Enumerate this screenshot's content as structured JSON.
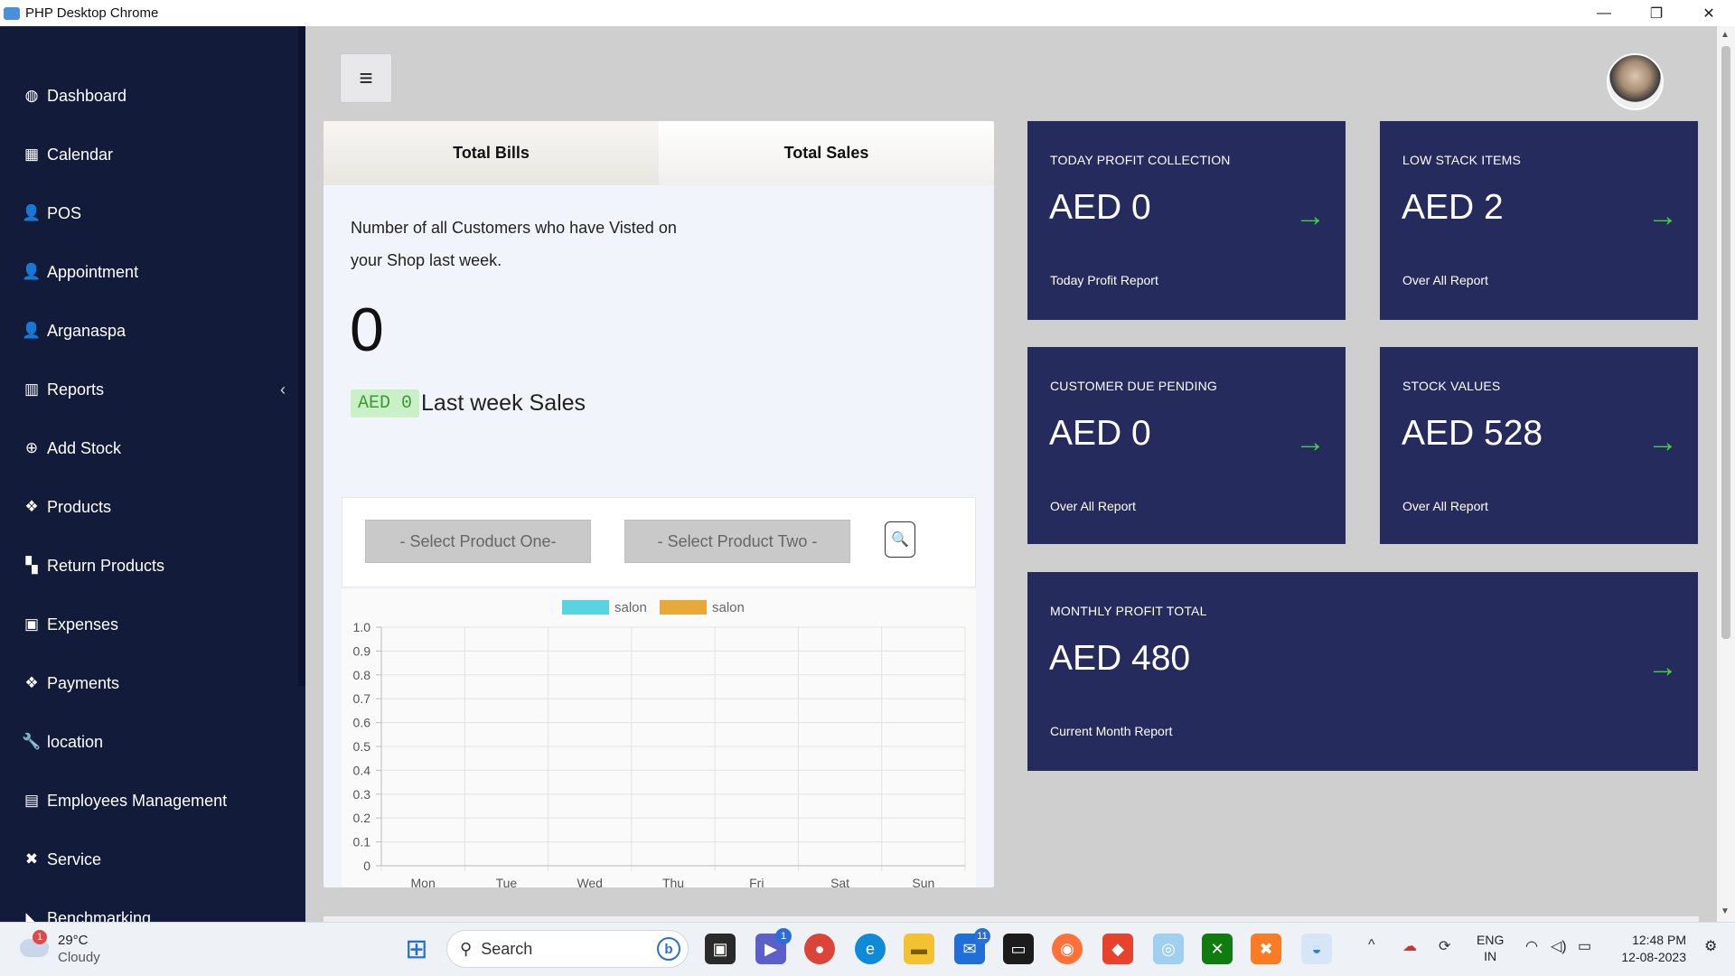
{
  "window": {
    "title": "PHP Desktop Chrome",
    "minimize": "—",
    "maximize": "❐",
    "close": "✕"
  },
  "sidebar": {
    "items": [
      {
        "label": "Dashboard",
        "icon": "dashboard-icon",
        "glyph": "◍"
      },
      {
        "label": "Calendar",
        "icon": "calendar-icon",
        "glyph": "▦"
      },
      {
        "label": "POS",
        "icon": "user-icon",
        "glyph": "👤"
      },
      {
        "label": "Appointment",
        "icon": "user-clock-icon",
        "glyph": "👤"
      },
      {
        "label": "Arganaspa",
        "icon": "user-icon",
        "glyph": "👤"
      },
      {
        "label": "Reports",
        "icon": "bar-chart-icon",
        "glyph": "▥",
        "chevron": "‹"
      },
      {
        "label": "Add Stock",
        "icon": "plus-circle-icon",
        "glyph": "⊕"
      },
      {
        "label": "Products",
        "icon": "cubes-icon",
        "glyph": "❖"
      },
      {
        "label": "Return Products",
        "icon": "boxes-icon",
        "glyph": "▚"
      },
      {
        "label": "Expenses",
        "icon": "money-icon",
        "glyph": "▣"
      },
      {
        "label": "Payments",
        "icon": "cubes-icon",
        "glyph": "❖"
      },
      {
        "label": "location",
        "icon": "wrench-icon",
        "glyph": "🔧"
      },
      {
        "label": "Employees Management",
        "icon": "id-card-icon",
        "glyph": "▤"
      },
      {
        "label": "Service",
        "icon": "tools-icon",
        "glyph": "✖"
      },
      {
        "label": "Benchmarking",
        "icon": "chart-area-icon",
        "glyph": "◣"
      }
    ]
  },
  "tabs": [
    {
      "label": "Total Bills"
    },
    {
      "label": "Total Sales"
    }
  ],
  "bills": {
    "description": "Number of all Customers who have Visted on your Shop last week.",
    "count": "0",
    "sales_badge": "AED 0",
    "sales_label": "Last week Sales"
  },
  "filters": {
    "product_one": "- Select Product One-",
    "product_two": "- Select Product Two -"
  },
  "chart_data": {
    "type": "bar",
    "categories": [
      "Mon",
      "Tue",
      "Wed",
      "Thu",
      "Fri",
      "Sat",
      "Sun"
    ],
    "series": [
      {
        "name": "salon",
        "color": "#5ad3e0",
        "values": [
          0,
          0,
          0,
          0,
          0,
          0,
          0
        ]
      },
      {
        "name": "salon",
        "color": "#e9a93a",
        "values": [
          0,
          0,
          0,
          0,
          0,
          0,
          0
        ]
      }
    ],
    "yticks": [
      "1.0",
      "0.9",
      "0.8",
      "0.7",
      "0.6",
      "0.5",
      "0.4",
      "0.3",
      "0.2",
      "0.1",
      "0"
    ],
    "ylim": [
      0,
      1.0
    ],
    "grid": true,
    "legend": "top"
  },
  "stats": [
    {
      "label": "TODAY PROFIT COLLECTION",
      "value": "AED 0",
      "link": "Today Profit Report"
    },
    {
      "label": "LOW STACK ITEMS",
      "value": "AED 2",
      "link": "Over All Report"
    },
    {
      "label": "CUSTOMER DUE PENDING",
      "value": "AED 0",
      "link": "Over All Report"
    },
    {
      "label": "STOCK VALUES",
      "value": "AED 528",
      "link": "Over All Report"
    },
    {
      "label": "MONTHLY PROFIT TOTAL",
      "value": "AED 480",
      "link": "Current Month Report"
    }
  ],
  "taskbar": {
    "weather_temp": "29°C",
    "weather_desc": "Cloudy",
    "weather_badge": "1",
    "search_label": "Search",
    "lang_top": "ENG",
    "lang_bottom": "IN",
    "time": "12:48 PM",
    "date": "12-08-2023",
    "badge_teams": "1",
    "badge_mail": "11"
  },
  "colors": {
    "sidebar": "#121b3a",
    "stat_card": "#262b5e",
    "arrow": "#3fd33a"
  }
}
